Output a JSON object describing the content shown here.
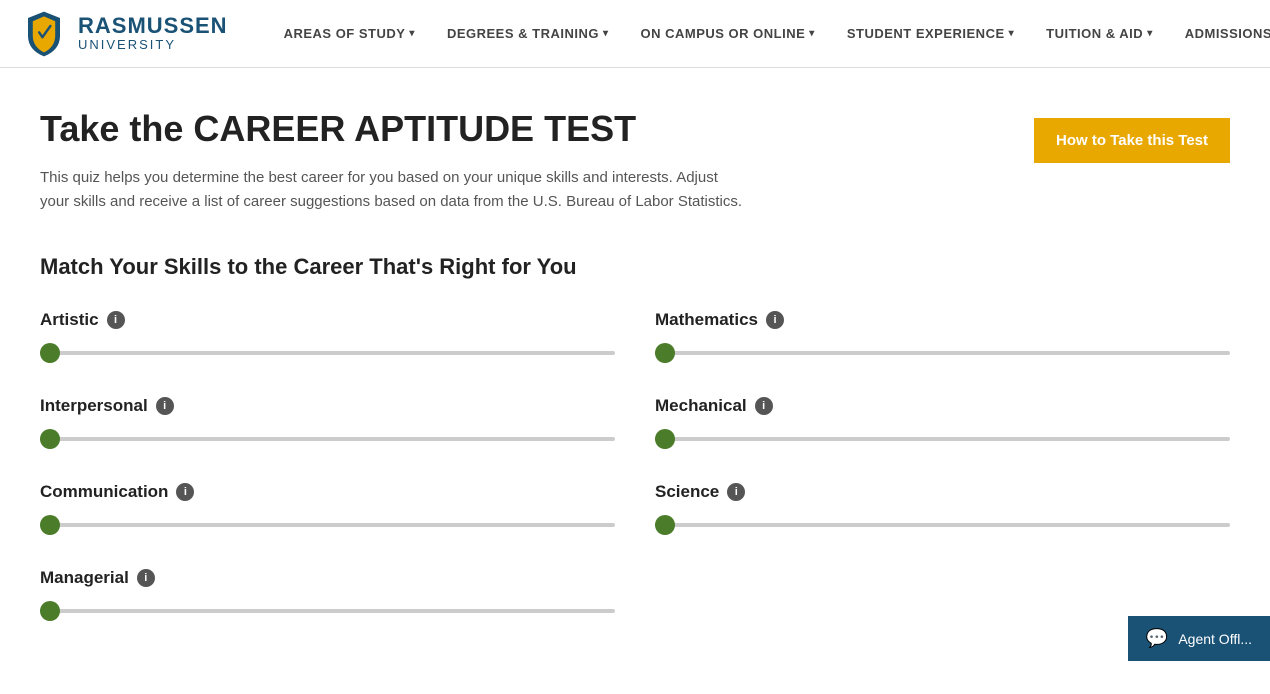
{
  "nav": {
    "logo": {
      "rasmussen": "RASMUSSEN",
      "university": "UNIVERSITY"
    },
    "links": [
      {
        "label": "AREAS OF STUDY",
        "id": "areas-of-study",
        "hasDropdown": true
      },
      {
        "label": "DEGREES & TRAINING",
        "id": "degrees-training",
        "hasDropdown": true
      },
      {
        "label": "ON CAMPUS OR ONLINE",
        "id": "on-campus-online",
        "hasDropdown": true
      },
      {
        "label": "STUDENT EXPERIENCE",
        "id": "student-experience",
        "hasDropdown": true
      },
      {
        "label": "TUITION & AID",
        "id": "tuition-aid",
        "hasDropdown": true
      },
      {
        "label": "ADMISSIONS",
        "id": "admissions",
        "hasDropdown": true
      }
    ]
  },
  "page": {
    "title_prefix": "Take the ",
    "title_highlight": "CAREER APTITUDE TEST",
    "description_1": "This quiz helps you determine the best career for you based on your unique skills and interests. Adjust",
    "description_2": "your skills and receive a list of career suggestions based on data from the U.S. Bureau of Labor Statistics.",
    "how_to_btn": "How to Take this Test",
    "skills_section_title": "Match Your Skills to the Career That's Right for You"
  },
  "skills": {
    "left": [
      {
        "id": "artistic",
        "name": "Artistic",
        "value": 0
      },
      {
        "id": "interpersonal",
        "name": "Interpersonal",
        "value": 0
      },
      {
        "id": "communication",
        "name": "Communication",
        "value": 0
      },
      {
        "id": "managerial",
        "name": "Managerial",
        "value": 0
      }
    ],
    "right": [
      {
        "id": "mathematics",
        "name": "Mathematics",
        "value": 0
      },
      {
        "id": "mechanical",
        "name": "Mechanical",
        "value": 0
      },
      {
        "id": "science",
        "name": "Science",
        "value": 0
      }
    ]
  },
  "livechat": {
    "label": "Agent Offl..."
  }
}
